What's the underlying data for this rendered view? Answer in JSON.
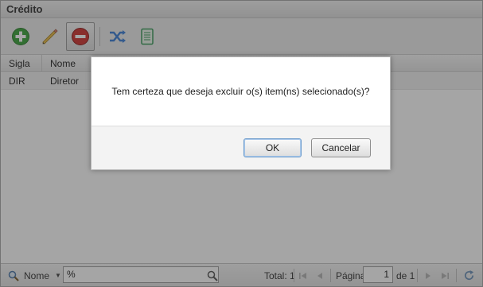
{
  "window": {
    "title": "Crédito"
  },
  "toolbar": {
    "buttons": [
      {
        "name": "add",
        "icon": "plus-circle-icon",
        "color": "#3aa33a"
      },
      {
        "name": "edit",
        "icon": "pencil-icon",
        "color": "#e0b43a"
      },
      {
        "name": "delete",
        "icon": "delete-circle-icon",
        "color": "#c9302c"
      },
      {
        "name": "shuffle",
        "icon": "shuffle-icon",
        "color": "#3b7fd6"
      },
      {
        "name": "notes",
        "icon": "notebook-icon",
        "color": "#3a9a5a"
      }
    ]
  },
  "grid": {
    "columns": [
      "Sigla",
      "Nome"
    ],
    "rows": [
      {
        "sigla": "DIR",
        "nome": "Diretor"
      }
    ]
  },
  "paging": {
    "search_field_label": "Nome",
    "search_value": "%",
    "total_label": "Total: 1",
    "page_label": "Página",
    "page_value": "1",
    "of_label": "de 1"
  },
  "dialog": {
    "message": "Tem certeza que deseja excluir o(s) item(ns) selecionado(s)?",
    "ok_label": "OK",
    "cancel_label": "Cancelar"
  }
}
